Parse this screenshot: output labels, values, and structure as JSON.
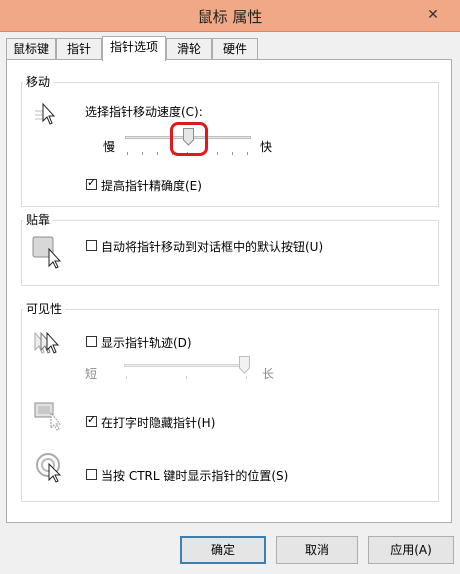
{
  "window": {
    "title": "鼠标 属性",
    "close_glyph": "✕"
  },
  "tabs": [
    {
      "label": "鼠标键"
    },
    {
      "label": "指针"
    },
    {
      "label": "指针选项"
    },
    {
      "label": "滑轮"
    },
    {
      "label": "硬件"
    }
  ],
  "motion": {
    "title": "移动",
    "speed_label": "选择指针移动速度(C):",
    "slow_label": "慢",
    "fast_label": "快",
    "speed_value": 0.5,
    "precision_label": "提高指针精确度(E)",
    "precision_checked": true
  },
  "snap": {
    "title": "贴靠",
    "snap_label": "自动将指针移动到对话框中的默认按钮(U)",
    "snap_checked": false
  },
  "visibility": {
    "title": "可见性",
    "trails_label": "显示指针轨迹(D)",
    "trails_checked": false,
    "short_label": "短",
    "long_label": "长",
    "trails_value": 1.0,
    "hide_label": "在打字时隐藏指针(H)",
    "hide_checked": true,
    "ctrl_label": "当按 CTRL 键时显示指针的位置(S)",
    "ctrl_checked": false
  },
  "buttons": {
    "ok": "确定",
    "cancel": "取消",
    "apply": "应用(A)"
  },
  "colors": {
    "title_bar": "#f0a886",
    "highlight": "#e01a1a",
    "default_button_border": "#3c7fb1"
  }
}
